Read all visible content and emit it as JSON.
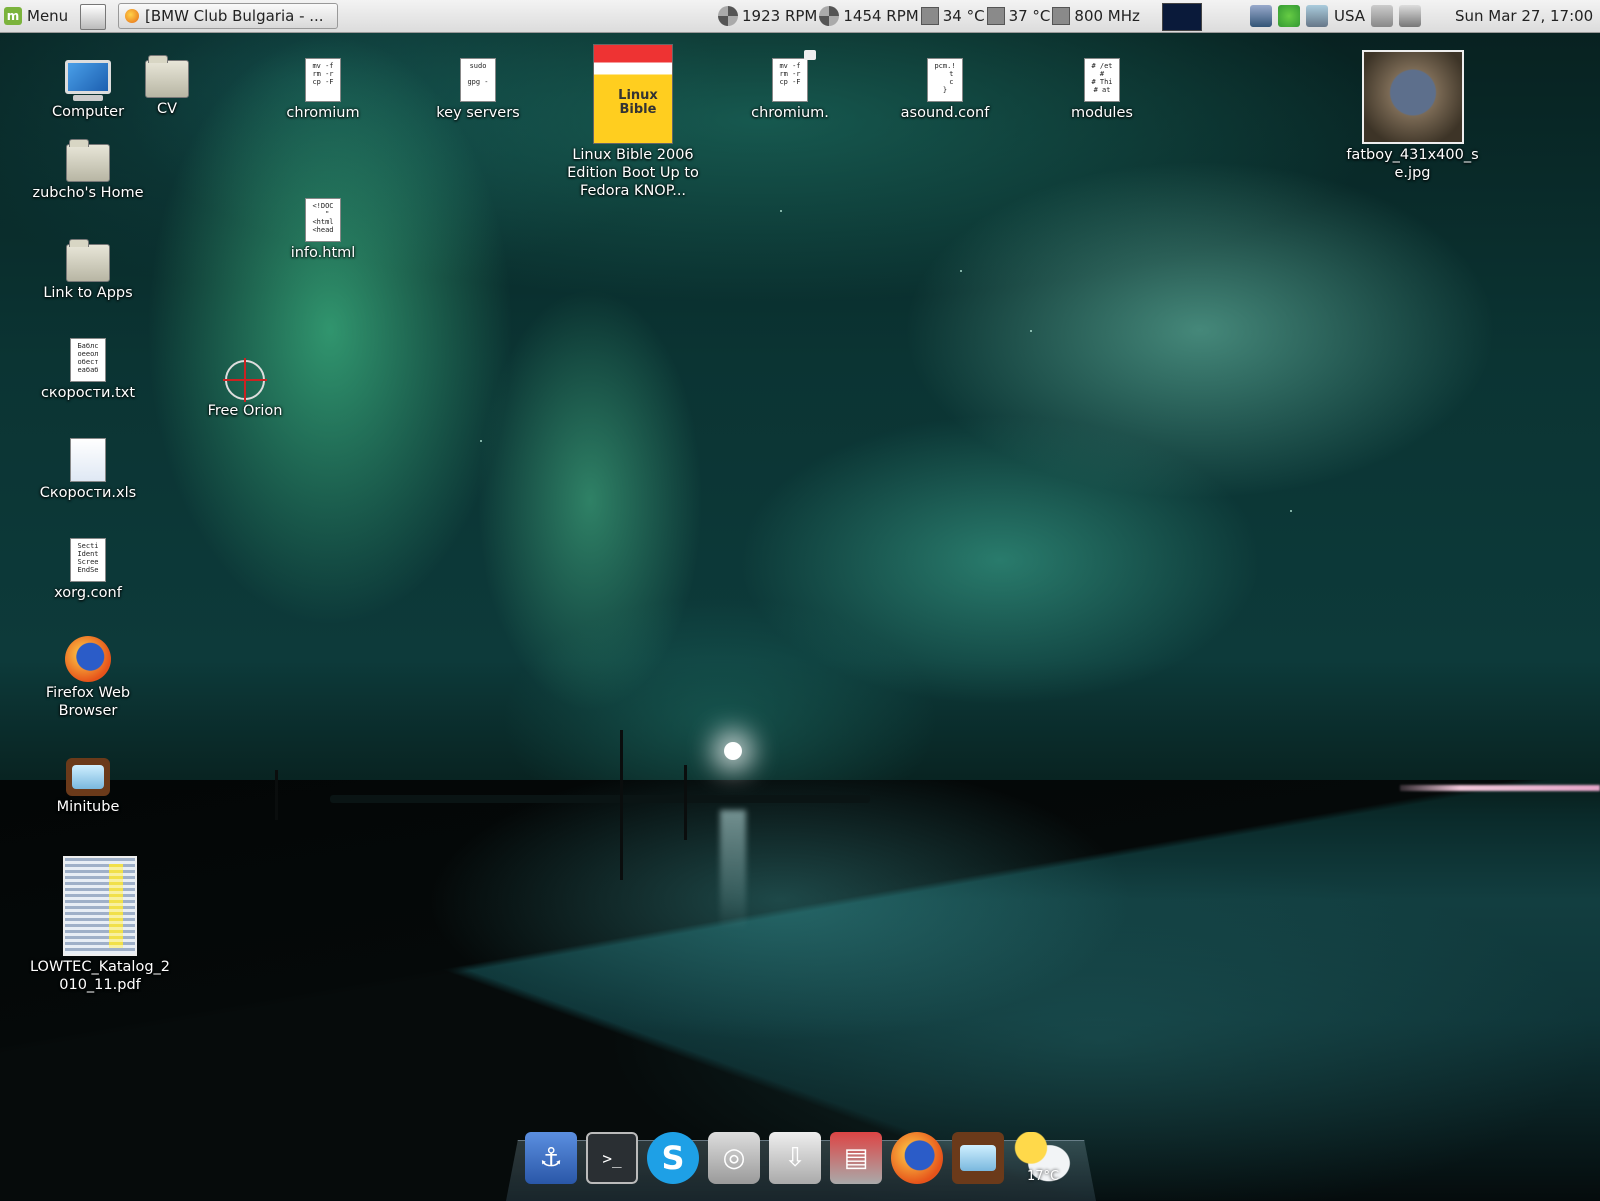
{
  "panel": {
    "menu_label": "Menu",
    "task_title": "[BMW Club Bulgaria - ...",
    "sensors": {
      "fan1": "1923 RPM",
      "fan2": "1454 RPM",
      "temp1": "34 °C",
      "temp2": "37 °C",
      "cpu_freq": "800 MHz"
    },
    "keyboard_layout": "USA",
    "clock": "Sun Mar 27, 17:00"
  },
  "desktop_icons": {
    "computer": "Computer",
    "cv": "CV",
    "home": "zubcho's Home",
    "link_apps": "Link to Apps",
    "skorosti_txt": "скорости.txt",
    "skorosti_xls": "Скорости.xls",
    "xorg": "xorg.conf",
    "firefox": "Firefox Web Browser",
    "minitube": "Minitube",
    "lowtec": "LOWTEC_Katalog_2010_11.pdf",
    "chromium": "chromium",
    "info_html": "info.html",
    "free_orion": "Free Orion",
    "key_servers": "key servers",
    "linux_bible": "Linux Bible 2006 Edition Boot Up to Fedora KNOP...",
    "chromium2": "chromium.",
    "asound": "asound.conf",
    "modules": "modules",
    "fatboy": "fatboy_431x400_se.jpg"
  },
  "doc_previews": {
    "chromium": "mv -f\nrm -r\ncp -F",
    "key_servers": "sudo\n\ngpg -",
    "info_html": "<!DOC\n  \"\n<html\n<head",
    "chromium2": "mv -f\nrm -r\ncp -F",
    "asound": "pcm.!\n   t\n   c\n}",
    "modules": "# /et\n#\n# Thi\n# at",
    "skorosti_txt": "Баблс\nоееол\nобест\nеабаб",
    "xorg": "Secti\nIdent\nScree\nEndSe"
  },
  "dock": {
    "weather_temp": "17°C"
  }
}
